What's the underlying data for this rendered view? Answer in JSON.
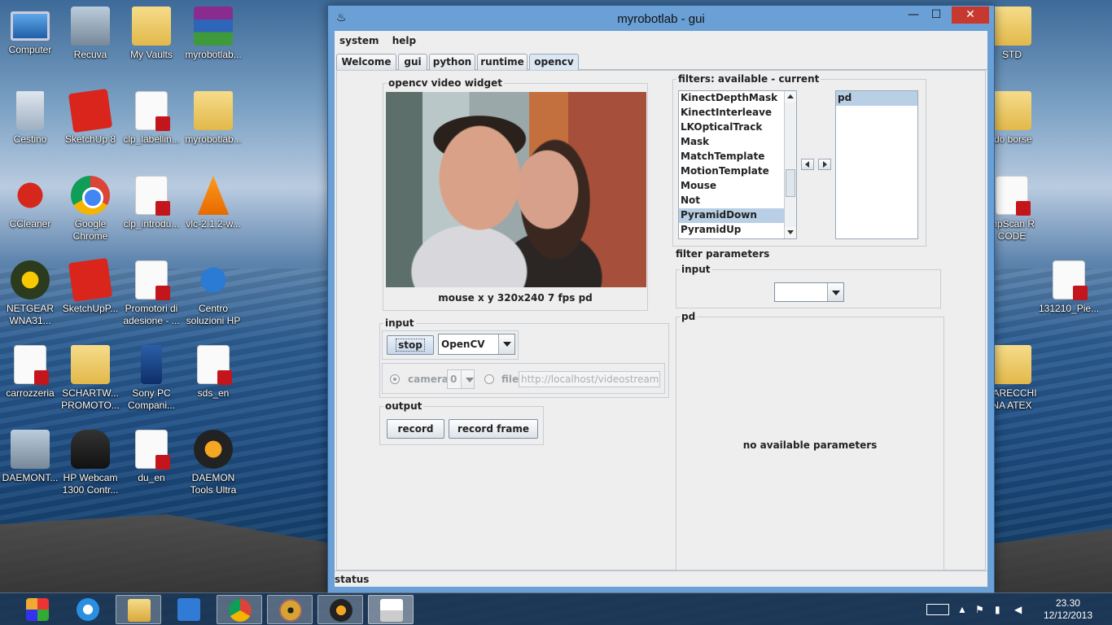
{
  "desktop": {
    "icons_left": [
      {
        "label": "Computer",
        "icon": "computer-icon"
      },
      {
        "label": "Recuva",
        "icon": "recuva-icon"
      },
      {
        "label": "My Vaults",
        "icon": "folder-icon"
      },
      {
        "label": "myrobotlab...",
        "icon": "winrar-icon"
      },
      {
        "label": "Cestino",
        "icon": "recycle-bin-icon"
      },
      {
        "label": "SketchUp 8",
        "icon": "sketchup-icon"
      },
      {
        "label": "clp_labellin...",
        "icon": "pdf-icon"
      },
      {
        "label": "myrobotlab...",
        "icon": "folder-icon"
      },
      {
        "label": "CCleaner",
        "icon": "ccleaner-icon"
      },
      {
        "label": "Google Chrome",
        "icon": "chrome-icon"
      },
      {
        "label": "clp_introdu...",
        "icon": "pdf-icon"
      },
      {
        "label": "vlc-2.1.2-w...",
        "icon": "vlc-icon"
      },
      {
        "label": "NETGEAR WNA31...",
        "icon": "netgear-icon"
      },
      {
        "label": "SketchUpP...",
        "icon": "sketchup-icon"
      },
      {
        "label": "Promotori di adesione - ...",
        "icon": "pdf-icon"
      },
      {
        "label": "Centro soluzioni HP",
        "icon": "hp-icon"
      },
      {
        "label": "carrozzeria",
        "icon": "pdf-icon"
      },
      {
        "label": "SCHARTW... PROMOTO...",
        "icon": "folder-icon"
      },
      {
        "label": "Sony PC Compani...",
        "icon": "phone-icon"
      },
      {
        "label": "sds_en",
        "icon": "pdf-icon"
      },
      {
        "label": "DAEMONT...",
        "icon": "installer-icon"
      },
      {
        "label": "HP Webcam 1300 Contr...",
        "icon": "webcam-icon"
      },
      {
        "label": "du_en",
        "icon": "pdf-icon"
      },
      {
        "label": "DAEMON Tools Ultra",
        "icon": "daemon-icon"
      }
    ],
    "icons_right": [
      {
        "label": "STD",
        "icon": "folder-icon"
      },
      {
        "label": "ido borse",
        "icon": "folder-icon"
      },
      {
        "label": "mpScan R CODE",
        "icon": "pdf-icon"
      },
      {
        "label": "131210_Pie...",
        "icon": "pdf-icon"
      },
      {
        "label": "PARECCHI NA ATEX",
        "icon": "folder-icon"
      }
    ]
  },
  "window": {
    "title": "myrobotlab - gui",
    "menu": [
      "system",
      "help"
    ],
    "tabs": [
      "Welcome",
      "gui",
      "python",
      "runtime",
      "opencv"
    ],
    "selected_tab": "opencv",
    "status_label": "status"
  },
  "video_widget": {
    "title": "opencv  video widget",
    "caption": "mouse x y  320x240  7 fps  pd"
  },
  "input_group": {
    "title": "input",
    "stop_label": "stop",
    "grabber_value": "OpenCV",
    "camera_label": "camera",
    "camera_index": "0",
    "file_label": "file",
    "file_url": "http://localhost/videostream.cgi"
  },
  "output_group": {
    "title": "output",
    "record_label": "record",
    "record_frame_label": "record frame"
  },
  "filters": {
    "title": "filters: available - current",
    "available": [
      "KinectDepthMask",
      "KinectInterleave",
      "LKOpticalTrack",
      "Mask",
      "MatchTemplate",
      "MotionTemplate",
      "Mouse",
      "Not",
      "PyramidDown",
      "PyramidUp"
    ],
    "selected_available": "PyramidDown",
    "current": [
      "pd"
    ]
  },
  "filter_parameters": {
    "title": "filter parameters",
    "input_title": "input",
    "input_value": "",
    "pd_title": "pd",
    "empty_message": "no available parameters"
  },
  "taskbar": {
    "time": "23.30",
    "date": "12/12/2013"
  }
}
